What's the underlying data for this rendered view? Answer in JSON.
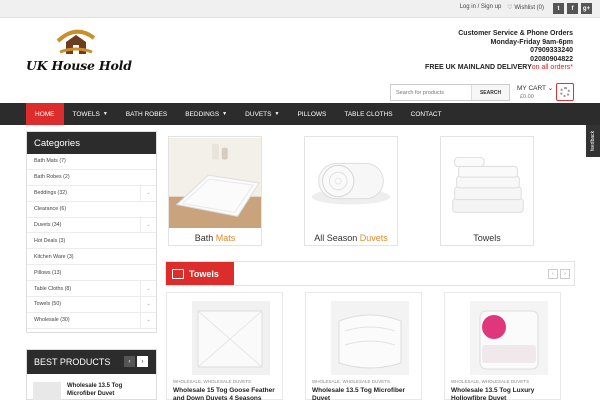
{
  "topbar": {
    "login": "Log in / Sign up",
    "wishlist": "Wishlist (0)",
    "social": [
      "t",
      "f",
      "g+"
    ]
  },
  "logo": {
    "brand": "UK House Hold"
  },
  "contact": {
    "line1": "Customer Service & Phone Orders",
    "line2": "Monday-Friday 9am-6pm",
    "phone1": "07909333240",
    "phone2": "02080904822",
    "delivery_main": "FREE UK MAINLAND DELIVERY",
    "delivery_tail": "on all orders*"
  },
  "search": {
    "placeholder": "Search for products",
    "button": "SEARCH"
  },
  "cart": {
    "label": "MY CART",
    "amount": "£0.00"
  },
  "nav": [
    {
      "label": "HOME",
      "active": true
    },
    {
      "label": "TOWELS",
      "dropdown": true
    },
    {
      "label": "BATH ROBES"
    },
    {
      "label": "BEDDINGS",
      "dropdown": true
    },
    {
      "label": "DUVETS",
      "dropdown": true
    },
    {
      "label": "PILLOWS"
    },
    {
      "label": "TABLE CLOTHS"
    },
    {
      "label": "CONTACT"
    }
  ],
  "feedback": "feedback",
  "categories": {
    "title": "Categories",
    "items": [
      {
        "label": "Bath Mats (7)"
      },
      {
        "label": "Bath Robes (2)"
      },
      {
        "label": "Beddings (32)",
        "expand": true
      },
      {
        "label": "Clearance (6)"
      },
      {
        "label": "Duvets (34)",
        "expand": true
      },
      {
        "label": "Hot Deals (3)"
      },
      {
        "label": "Kitchen Ware (3)"
      },
      {
        "label": "Pillows (13)"
      },
      {
        "label": "Table Cloths (8)",
        "expand": true
      },
      {
        "label": "Towels (50)",
        "expand": true
      },
      {
        "label": "Wholesale (30)",
        "expand": true
      }
    ]
  },
  "best_products": {
    "title": "BEST PRODUCTS",
    "first": "Wholesale 13.5 Tog Microfiber Duvet"
  },
  "featured": [
    {
      "word": "Bath",
      "highlight": "Mats"
    },
    {
      "word": "All Season",
      "highlight": "Duvets"
    },
    {
      "word": "Towels",
      "highlight": ""
    }
  ],
  "section": {
    "title": "Towels"
  },
  "products": [
    {
      "meta": "WHOLESALE, WHOLESALE DUVETS",
      "name": "Wholesale 15 Tog Goose Feather and Down Duvets 4 Seasons"
    },
    {
      "meta": "WHOLESALE, WHOLESALE DUVETS",
      "name": "Wholesale 13.5 Tog Microfiber Duvet"
    },
    {
      "meta": "WHOLESALE, WHOLESALE DUVETS",
      "name": "Wholesale 13.5 Tog Luxury Hollowfibre Duvet"
    }
  ]
}
